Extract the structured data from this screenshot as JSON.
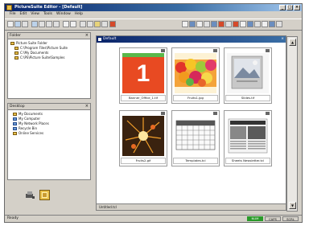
{
  "window": {
    "title": "PictureSuite Editor - [Default]"
  },
  "menubar": [
    "File",
    "Edit",
    "View",
    "Tools",
    "Window",
    "Help"
  ],
  "left": {
    "folders_title": "Folder",
    "folders": [
      "Picture Suite Folder",
      "C:\\Program Files\\Picture Suite",
      "C:\\My Documents",
      "C:\\PS\\Picture Suite\\Samples"
    ],
    "locations_title": "Desktop",
    "locations": [
      "My Documents",
      "My Computer",
      "My Network Places",
      "Recycle Bin",
      "Online Services"
    ]
  },
  "main": {
    "title": "Default",
    "footer": "Untitled.tcl",
    "items": [
      {
        "caption": "Banner_Ofﬁce_1.tif",
        "number": "1",
        "type": "banner"
      },
      {
        "caption": "Fruits1.jpg",
        "type": "fruits"
      },
      {
        "caption": "Slides.tif",
        "type": "slides"
      },
      {
        "caption": "Fruits2.gif",
        "type": "fireworks"
      },
      {
        "caption": "Templates.tcl",
        "type": "table"
      },
      {
        "caption": "Sheets Newsletter.tcl",
        "type": "newsletter"
      }
    ]
  },
  "status": {
    "left": "Ready",
    "green": "NUM",
    "box1": "CAPS",
    "box2": "SCRL"
  },
  "colors": {
    "title_bar": "#08246b",
    "accent_red": "#e84a22",
    "folder_yellow": "#e8c04a"
  }
}
